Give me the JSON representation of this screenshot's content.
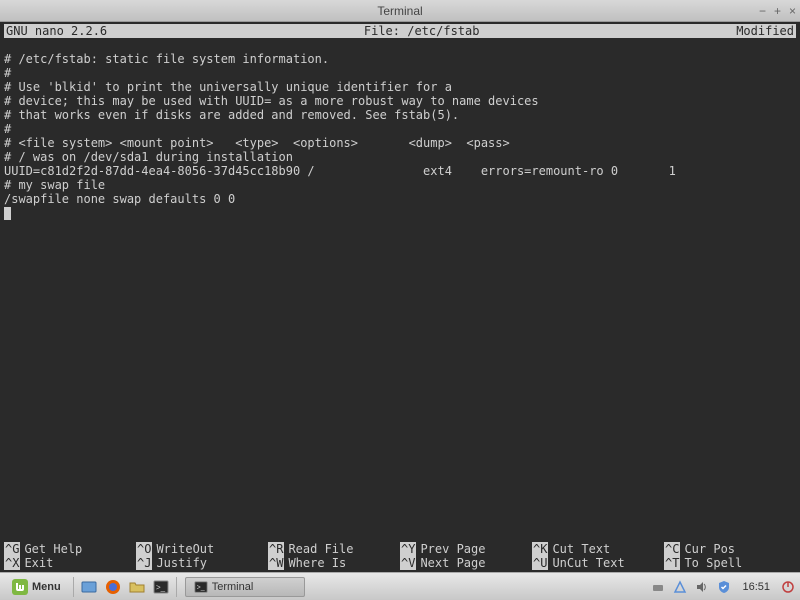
{
  "window": {
    "title": "Terminal"
  },
  "nano": {
    "app": "GNU nano 2.2.6",
    "file_label": "File: /etc/fstab",
    "status": "Modified",
    "lines": [
      "# /etc/fstab: static file system information.",
      "#",
      "# Use 'blkid' to print the universally unique identifier for a",
      "# device; this may be used with UUID= as a more robust way to name devices",
      "# that works even if disks are added and removed. See fstab(5).",
      "#",
      "# <file system> <mount point>   <type>  <options>       <dump>  <pass>",
      "# / was on /dev/sda1 during installation",
      "UUID=c81d2f2d-87dd-4ea4-8056-37d45cc18b90 /               ext4    errors=remount-ro 0       1",
      "# my swap file",
      "/swapfile none swap defaults 0 0"
    ],
    "shortcuts_row1": [
      {
        "key": "^G",
        "label": "Get Help"
      },
      {
        "key": "^O",
        "label": "WriteOut"
      },
      {
        "key": "^R",
        "label": "Read File"
      },
      {
        "key": "^Y",
        "label": "Prev Page"
      },
      {
        "key": "^K",
        "label": "Cut Text"
      },
      {
        "key": "^C",
        "label": "Cur Pos"
      }
    ],
    "shortcuts_row2": [
      {
        "key": "^X",
        "label": "Exit"
      },
      {
        "key": "^J",
        "label": "Justify"
      },
      {
        "key": "^W",
        "label": "Where Is"
      },
      {
        "key": "^V",
        "label": "Next Page"
      },
      {
        "key": "^U",
        "label": "UnCut Text"
      },
      {
        "key": "^T",
        "label": "To Spell"
      }
    ]
  },
  "taskbar": {
    "menu_label": "Menu",
    "active_task": "Terminal",
    "clock": "16:51"
  }
}
